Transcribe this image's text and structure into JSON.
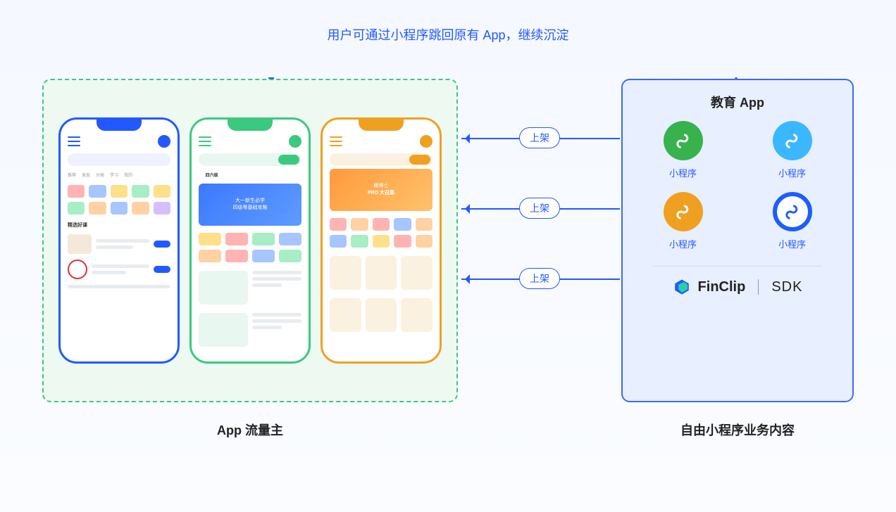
{
  "top_label": "用户可通过小程序跳回原有 App，继续沉淀",
  "left_caption": "App 流量主",
  "right_caption": "自由小程序业务内容",
  "shelf_label": "上架",
  "right_panel": {
    "title": "教育 App",
    "mp_label": "小程序",
    "brand": "FinClip",
    "sdk": "SDK"
  },
  "phones": {
    "blue": {
      "section": "精选好课",
      "tabs": [
        "推荐",
        "发现",
        "分类",
        "学习",
        "我的"
      ]
    },
    "green": {
      "tab_badge": "四六级",
      "banner_line1": "大一新生必学",
      "banner_line2": "四级零基础攻略"
    },
    "orange": {
      "banner_line1": "雁博士",
      "banner_line2": "PRO 大召集"
    }
  }
}
